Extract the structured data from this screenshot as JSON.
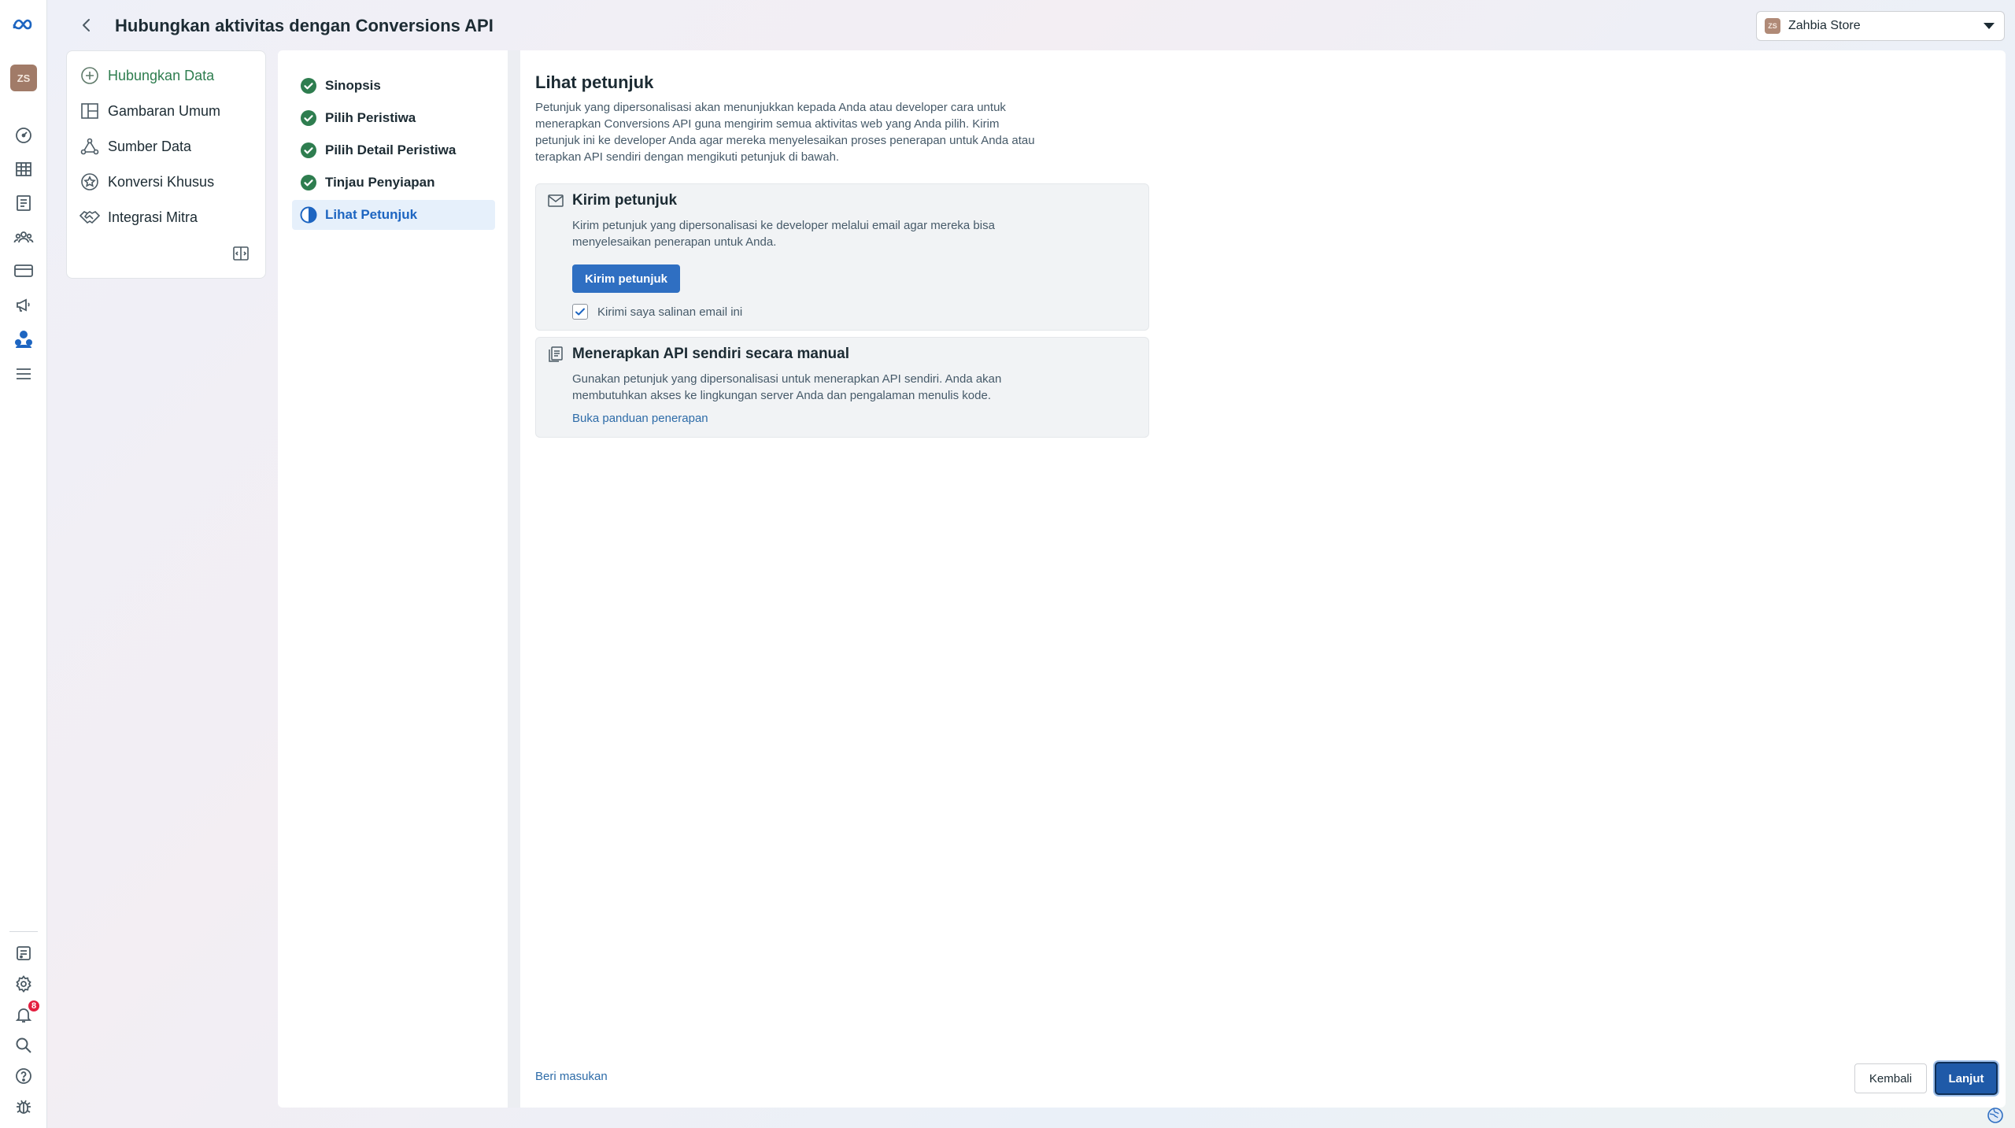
{
  "header": {
    "title": "Hubungkan aktivitas dengan Conversions API",
    "account_name": "Zahbia Store",
    "account_initials": "ZS"
  },
  "rail": {
    "notification_count": "8",
    "icons": [
      "meta-logo-icon",
      "dashboard-icon",
      "table-icon",
      "catalog-icon",
      "audience-icon",
      "billing-icon",
      "megaphone-icon",
      "events-manager-icon",
      "menu-icon",
      "library-icon",
      "settings-icon",
      "notification-bell-icon",
      "search-icon",
      "help-icon",
      "bug-icon"
    ]
  },
  "nav": {
    "items": [
      {
        "label": "Hubungkan Data",
        "icon": "plus-circle-icon"
      },
      {
        "label": "Gambaran Umum",
        "icon": "overview-icon"
      },
      {
        "label": "Sumber Data",
        "icon": "data-source-icon"
      },
      {
        "label": "Konversi Khusus",
        "icon": "star-badge-icon"
      },
      {
        "label": "Integrasi Mitra",
        "icon": "handshake-icon"
      }
    ]
  },
  "steps": [
    {
      "label": "Sinopsis",
      "status": "done"
    },
    {
      "label": "Pilih Peristiwa",
      "status": "done"
    },
    {
      "label": "Pilih Detail Peristiwa",
      "status": "done"
    },
    {
      "label": "Tinjau Penyiapan",
      "status": "done"
    },
    {
      "label": "Lihat Petunjuk",
      "status": "current"
    }
  ],
  "main": {
    "title": "Lihat petunjuk",
    "description": "Petunjuk yang dipersonalisasi akan menunjukkan kepada Anda atau developer cara untuk menerapkan Conversions API guna mengirim semua aktivitas web yang Anda pilih. Kirim petunjuk ini ke developer Anda agar mereka menyelesaikan proses penerapan untuk Anda atau terapkan API sendiri dengan mengikuti petunjuk di bawah.",
    "send_card": {
      "title": "Kirim petunjuk",
      "description": "Kirim petunjuk yang dipersonalisasi ke developer melalui email agar mereka bisa menyelesaikan penerapan untuk Anda.",
      "button": "Kirim petunjuk",
      "checkbox_label": "Kirimi saya salinan email ini",
      "checked": true
    },
    "manual_card": {
      "title": "Menerapkan API sendiri secara manual",
      "description": "Gunakan petunjuk yang dipersonalisasi untuk menerapkan API sendiri. Anda akan membutuhkan akses ke lingkungan server Anda dan pengalaman menulis kode.",
      "link": "Buka panduan penerapan"
    },
    "feedback_link": "Beri masukan",
    "back_button": "Kembali",
    "next_button": "Lanjut"
  },
  "colors": {
    "primary": "#2f6fc2",
    "success": "#2e7d4f",
    "link": "#2e6ca8"
  }
}
